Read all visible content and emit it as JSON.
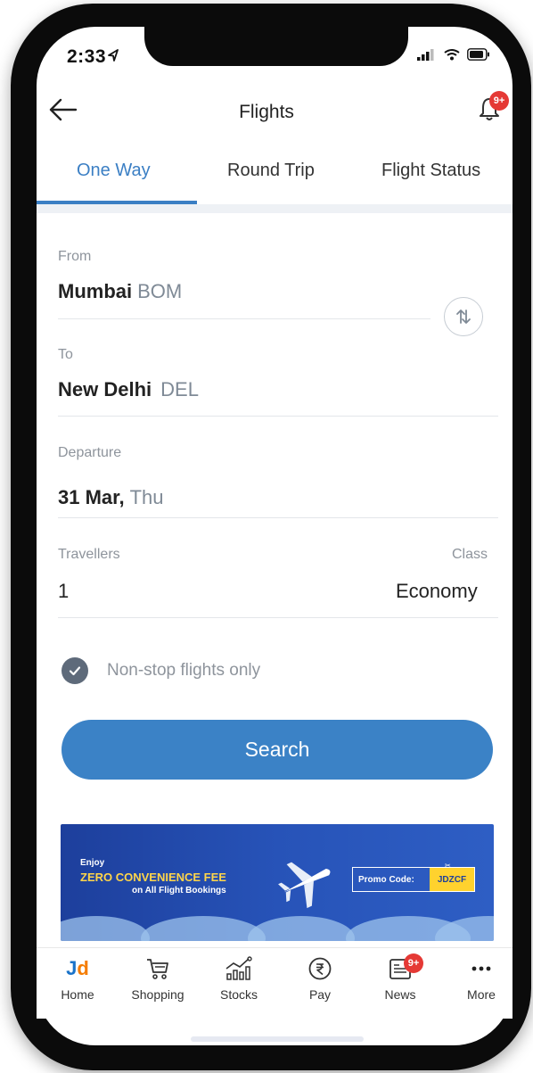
{
  "status_bar": {
    "time": "2:33"
  },
  "header": {
    "title": "Flights",
    "bell_badge": "9+"
  },
  "tabs": [
    {
      "label": "One Way",
      "active": true
    },
    {
      "label": "Round Trip",
      "active": false
    },
    {
      "label": "Flight Status",
      "active": false
    }
  ],
  "form": {
    "from": {
      "label": "From",
      "city": "Mumbai",
      "code": "BOM"
    },
    "to": {
      "label": "To",
      "city": "New Delhi",
      "code": "DEL"
    },
    "departure": {
      "label": "Departure",
      "date": "31 Mar,",
      "day": "Thu"
    },
    "travellers": {
      "label": "Travellers",
      "value": "1"
    },
    "class": {
      "label": "Class",
      "value": "Economy"
    },
    "nonstop": {
      "label": "Non-stop flights only",
      "checked": true
    },
    "search_label": "Search"
  },
  "banner": {
    "enjoy": "Enjoy",
    "headline": "ZERO CONVENIENCE FEE",
    "sub": "on All Flight Bookings",
    "promo_label": "Promo Code:",
    "promo_code": "JDZCF"
  },
  "bottom_nav": [
    {
      "label": "Home",
      "icon": "jd-logo-icon"
    },
    {
      "label": "Shopping",
      "icon": "cart-icon"
    },
    {
      "label": "Stocks",
      "icon": "stocks-chart-icon"
    },
    {
      "label": "Pay",
      "icon": "rupee-icon"
    },
    {
      "label": "News",
      "icon": "news-icon",
      "badge": "9+"
    },
    {
      "label": "More",
      "icon": "more-dots-icon"
    }
  ],
  "colors": {
    "accent": "#3b7fc4",
    "button": "#3b82c6",
    "badge": "#e53935",
    "promo": "#ffd22e"
  }
}
